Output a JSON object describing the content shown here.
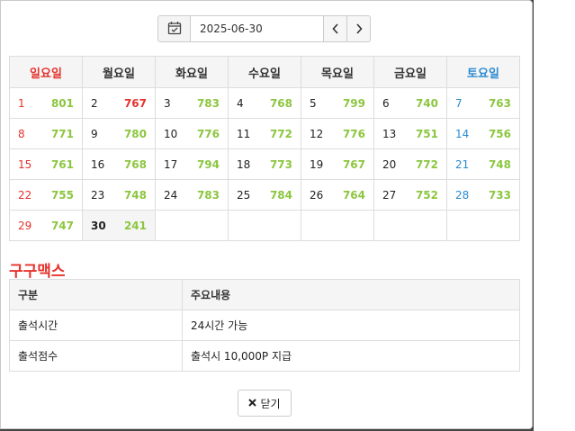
{
  "date": {
    "value": "2025-06-30"
  },
  "weekdays": [
    {
      "label": "일요일",
      "kind": "sun"
    },
    {
      "label": "월요일",
      "kind": ""
    },
    {
      "label": "화요일",
      "kind": ""
    },
    {
      "label": "수요일",
      "kind": ""
    },
    {
      "label": "목요일",
      "kind": ""
    },
    {
      "label": "금요일",
      "kind": ""
    },
    {
      "label": "토요일",
      "kind": "sat"
    }
  ],
  "weeks": [
    [
      {
        "day": "1",
        "value": "801"
      },
      {
        "day": "2",
        "value": "767",
        "red": true
      },
      {
        "day": "3",
        "value": "783"
      },
      {
        "day": "4",
        "value": "768"
      },
      {
        "day": "5",
        "value": "799"
      },
      {
        "day": "6",
        "value": "740"
      },
      {
        "day": "7",
        "value": "763"
      }
    ],
    [
      {
        "day": "8",
        "value": "771"
      },
      {
        "day": "9",
        "value": "780"
      },
      {
        "day": "10",
        "value": "776"
      },
      {
        "day": "11",
        "value": "772"
      },
      {
        "day": "12",
        "value": "776"
      },
      {
        "day": "13",
        "value": "751"
      },
      {
        "day": "14",
        "value": "756"
      }
    ],
    [
      {
        "day": "15",
        "value": "761"
      },
      {
        "day": "16",
        "value": "768"
      },
      {
        "day": "17",
        "value": "794"
      },
      {
        "day": "18",
        "value": "773"
      },
      {
        "day": "19",
        "value": "767"
      },
      {
        "day": "20",
        "value": "772"
      },
      {
        "day": "21",
        "value": "748"
      }
    ],
    [
      {
        "day": "22",
        "value": "755"
      },
      {
        "day": "23",
        "value": "748"
      },
      {
        "day": "24",
        "value": "783"
      },
      {
        "day": "25",
        "value": "784"
      },
      {
        "day": "26",
        "value": "764"
      },
      {
        "day": "27",
        "value": "752"
      },
      {
        "day": "28",
        "value": "733"
      }
    ],
    [
      {
        "day": "29",
        "value": "747"
      },
      {
        "day": "30",
        "value": "241",
        "today": true
      },
      {
        "day": "",
        "value": ""
      },
      {
        "day": "",
        "value": ""
      },
      {
        "day": "",
        "value": ""
      },
      {
        "day": "",
        "value": ""
      },
      {
        "day": "",
        "value": ""
      }
    ]
  ],
  "section": {
    "title": "구구맥스",
    "headers": [
      "구분",
      "주요내용"
    ],
    "rows": [
      [
        "출석시간",
        "24시간 가능"
      ],
      [
        "출석점수",
        "출석시 10,000P 지급"
      ]
    ]
  },
  "close_label": "닫기",
  "icons": {
    "calendar": "calendar-check-icon",
    "prev": "chevron-left-icon",
    "next": "chevron-right-icon",
    "close": "close-icon"
  }
}
